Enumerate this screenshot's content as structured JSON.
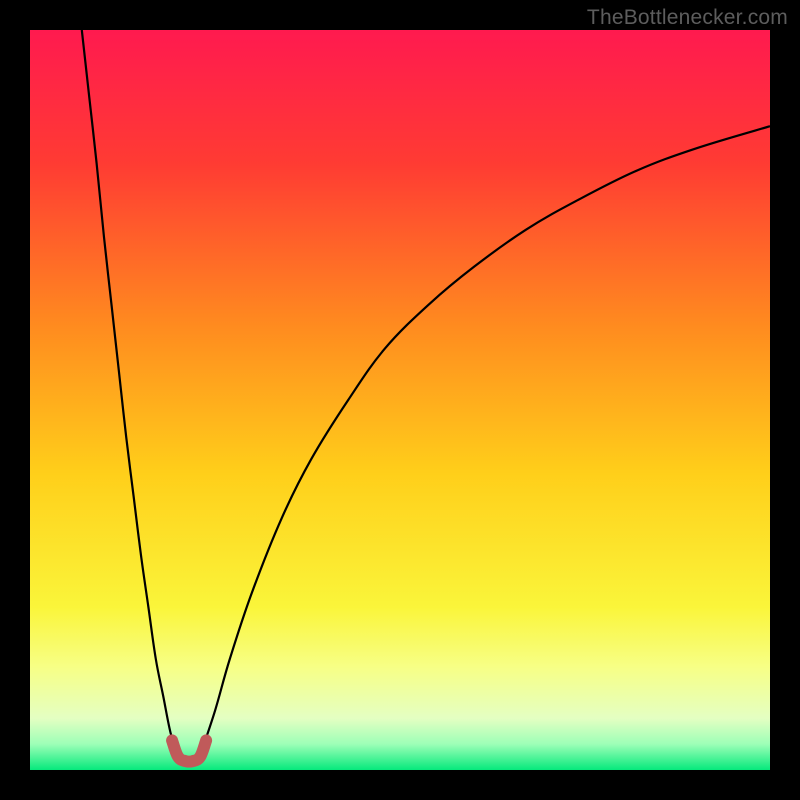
{
  "watermark": "TheBottlenecker.com",
  "chart_data": {
    "type": "line",
    "title": "",
    "xlabel": "",
    "ylabel": "",
    "xlim": [
      0,
      100
    ],
    "ylim": [
      0,
      100
    ],
    "gradient_stops": [
      {
        "offset": 0,
        "color": "#ff1a4f"
      },
      {
        "offset": 0.18,
        "color": "#ff3b33"
      },
      {
        "offset": 0.4,
        "color": "#ff8b1f"
      },
      {
        "offset": 0.6,
        "color": "#ffcf1a"
      },
      {
        "offset": 0.78,
        "color": "#faf53a"
      },
      {
        "offset": 0.86,
        "color": "#f7ff85"
      },
      {
        "offset": 0.93,
        "color": "#e4ffc2"
      },
      {
        "offset": 0.965,
        "color": "#9dffb7"
      },
      {
        "offset": 1.0,
        "color": "#06e97c"
      }
    ],
    "series": [
      {
        "name": "curve-left",
        "color": "#000000",
        "width": 2.2,
        "x": [
          7,
          8,
          9,
          10,
          11,
          12,
          13,
          14,
          15,
          16,
          17,
          18,
          19,
          20
        ],
        "y": [
          100,
          91,
          82,
          72,
          63,
          54,
          45,
          37,
          29,
          22,
          15,
          10,
          5,
          2
        ]
      },
      {
        "name": "curve-right",
        "color": "#000000",
        "width": 2.2,
        "x": [
          23,
          25,
          27,
          30,
          34,
          38,
          43,
          48,
          54,
          60,
          67,
          74,
          82,
          90,
          100
        ],
        "y": [
          2,
          8,
          15,
          24,
          34,
          42,
          50,
          57,
          63,
          68,
          73,
          77,
          81,
          84,
          87
        ]
      },
      {
        "name": "bottom-marker",
        "type": "marker-path",
        "color": "#c05a5a",
        "width": 12,
        "linecap": "round",
        "x": [
          19.2,
          20.0,
          21.0,
          22.0,
          23.0,
          23.8
        ],
        "y": [
          4.0,
          1.8,
          1.2,
          1.2,
          1.8,
          4.0
        ]
      }
    ]
  }
}
